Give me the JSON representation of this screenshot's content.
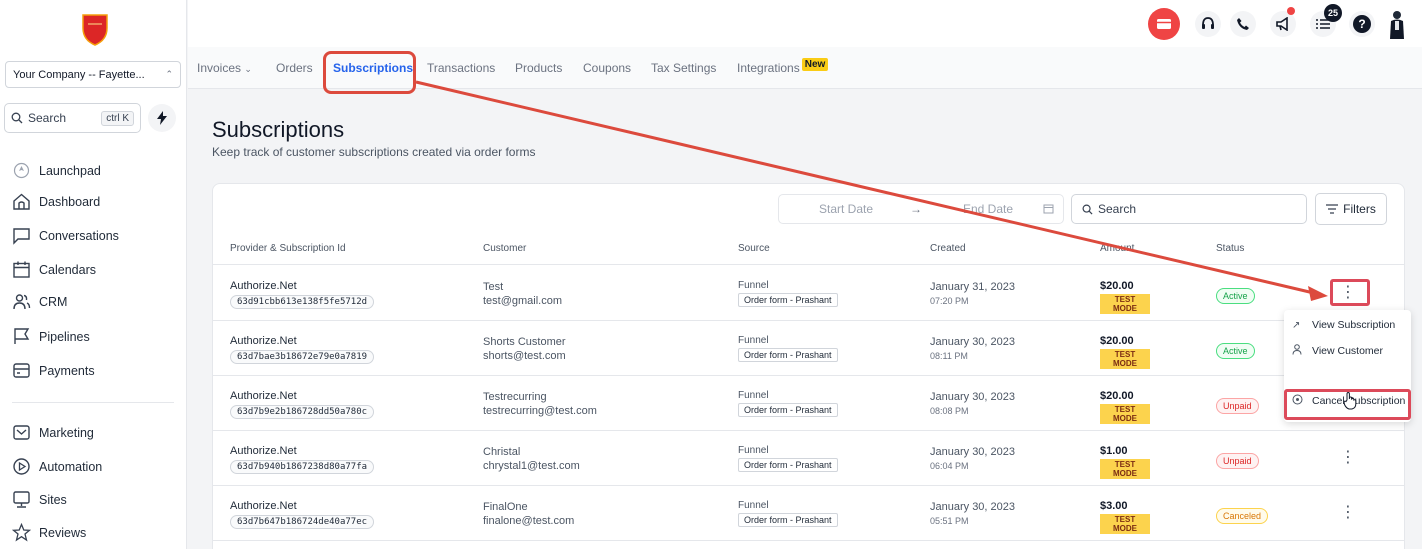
{
  "sidebar": {
    "company": "Your Company -- Fayette...",
    "search_label": "Search",
    "search_shortcut": "ctrl K",
    "nav": [
      {
        "label": "Launchpad",
        "icon": "launchpad-icon"
      },
      {
        "label": "Dashboard",
        "icon": "home-icon"
      },
      {
        "label": "Conversations",
        "icon": "chat-icon"
      },
      {
        "label": "Calendars",
        "icon": "calendar-icon"
      },
      {
        "label": "CRM",
        "icon": "contacts-icon"
      },
      {
        "label": "Pipelines",
        "icon": "flag-icon"
      },
      {
        "label": "Payments",
        "icon": "payments-icon"
      },
      {
        "label": "Marketing",
        "icon": "mail-icon"
      },
      {
        "label": "Automation",
        "icon": "play-icon"
      },
      {
        "label": "Sites",
        "icon": "monitor-icon"
      },
      {
        "label": "Reviews",
        "icon": "star-icon"
      }
    ]
  },
  "topbar": {
    "notification_count": "25",
    "icons": [
      "wallet-icon",
      "support-icon",
      "phone-icon",
      "megaphone-icon",
      "tasks-icon",
      "help-icon",
      "avatar"
    ]
  },
  "tabs": [
    {
      "label": "Invoices",
      "dropdown": true
    },
    {
      "label": "Orders"
    },
    {
      "label": "Subscriptions",
      "active": true
    },
    {
      "label": "Transactions"
    },
    {
      "label": "Products"
    },
    {
      "label": "Coupons"
    },
    {
      "label": "Tax Settings"
    },
    {
      "label": "Integrations",
      "badge": "New"
    }
  ],
  "page": {
    "title": "Subscriptions",
    "subtitle": "Keep track of customer subscriptions created via order forms"
  },
  "filters": {
    "start_date_placeholder": "Start Date",
    "end_date_placeholder": "End Date",
    "arrow": "→",
    "search_placeholder": "Search",
    "filters_label": "Filters"
  },
  "table": {
    "headers": [
      "Provider & Subscription Id",
      "Customer",
      "Source",
      "Created",
      "Amount",
      "Status"
    ],
    "rows": [
      {
        "provider": "Authorize.Net",
        "sub_id": "63d91cbb613e138f5fe5712d",
        "customer": "Test",
        "email": "test@gmail.com",
        "source": "Funnel",
        "source_tag": "Order form - Prashant",
        "date": "January 31, 2023",
        "time": "07:20 PM",
        "amount": "$20.00",
        "mode": "TEST MODE",
        "status": "Active"
      },
      {
        "provider": "Authorize.Net",
        "sub_id": "63d7bae3b18672e79e0a7819",
        "customer": "Shorts Customer",
        "email": "shorts@test.com",
        "source": "Funnel",
        "source_tag": "Order form - Prashant",
        "date": "January 30, 2023",
        "time": "08:11 PM",
        "amount": "$20.00",
        "mode": "TEST MODE",
        "status": "Active"
      },
      {
        "provider": "Authorize.Net",
        "sub_id": "63d7b9e2b186728dd50a780c",
        "customer": "Testrecurring",
        "email": "testrecurring@test.com",
        "source": "Funnel",
        "source_tag": "Order form - Prashant",
        "date": "January 30, 2023",
        "time": "08:08 PM",
        "amount": "$20.00",
        "mode": "TEST MODE",
        "status": "Unpaid"
      },
      {
        "provider": "Authorize.Net",
        "sub_id": "63d7b940b1867238d80a77fa",
        "customer": "Christal",
        "email": "chrystal1@test.com",
        "source": "Funnel",
        "source_tag": "Order form - Prashant",
        "date": "January 30, 2023",
        "time": "06:04 PM",
        "amount": "$1.00",
        "mode": "TEST MODE",
        "status": "Unpaid"
      },
      {
        "provider": "Authorize.Net",
        "sub_id": "63d7b647b186724de40a77ec",
        "customer": "FinalOne",
        "email": "finalone@test.com",
        "source": "Funnel",
        "source_tag": "Order form - Prashant",
        "date": "January 30, 2023",
        "time": "05:51 PM",
        "amount": "$3.00",
        "mode": "TEST MODE",
        "status": "Canceled"
      }
    ]
  },
  "menu": {
    "view_subscription": "View Subscription",
    "view_customer": "View Customer",
    "cancel_subscription": "Cancel Subscription"
  },
  "colors": {
    "accent": "#2563eb",
    "annotation": "#dc4a3d",
    "active": "#16a34a",
    "unpaid": "#dc2626",
    "canceled": "#d97706"
  }
}
